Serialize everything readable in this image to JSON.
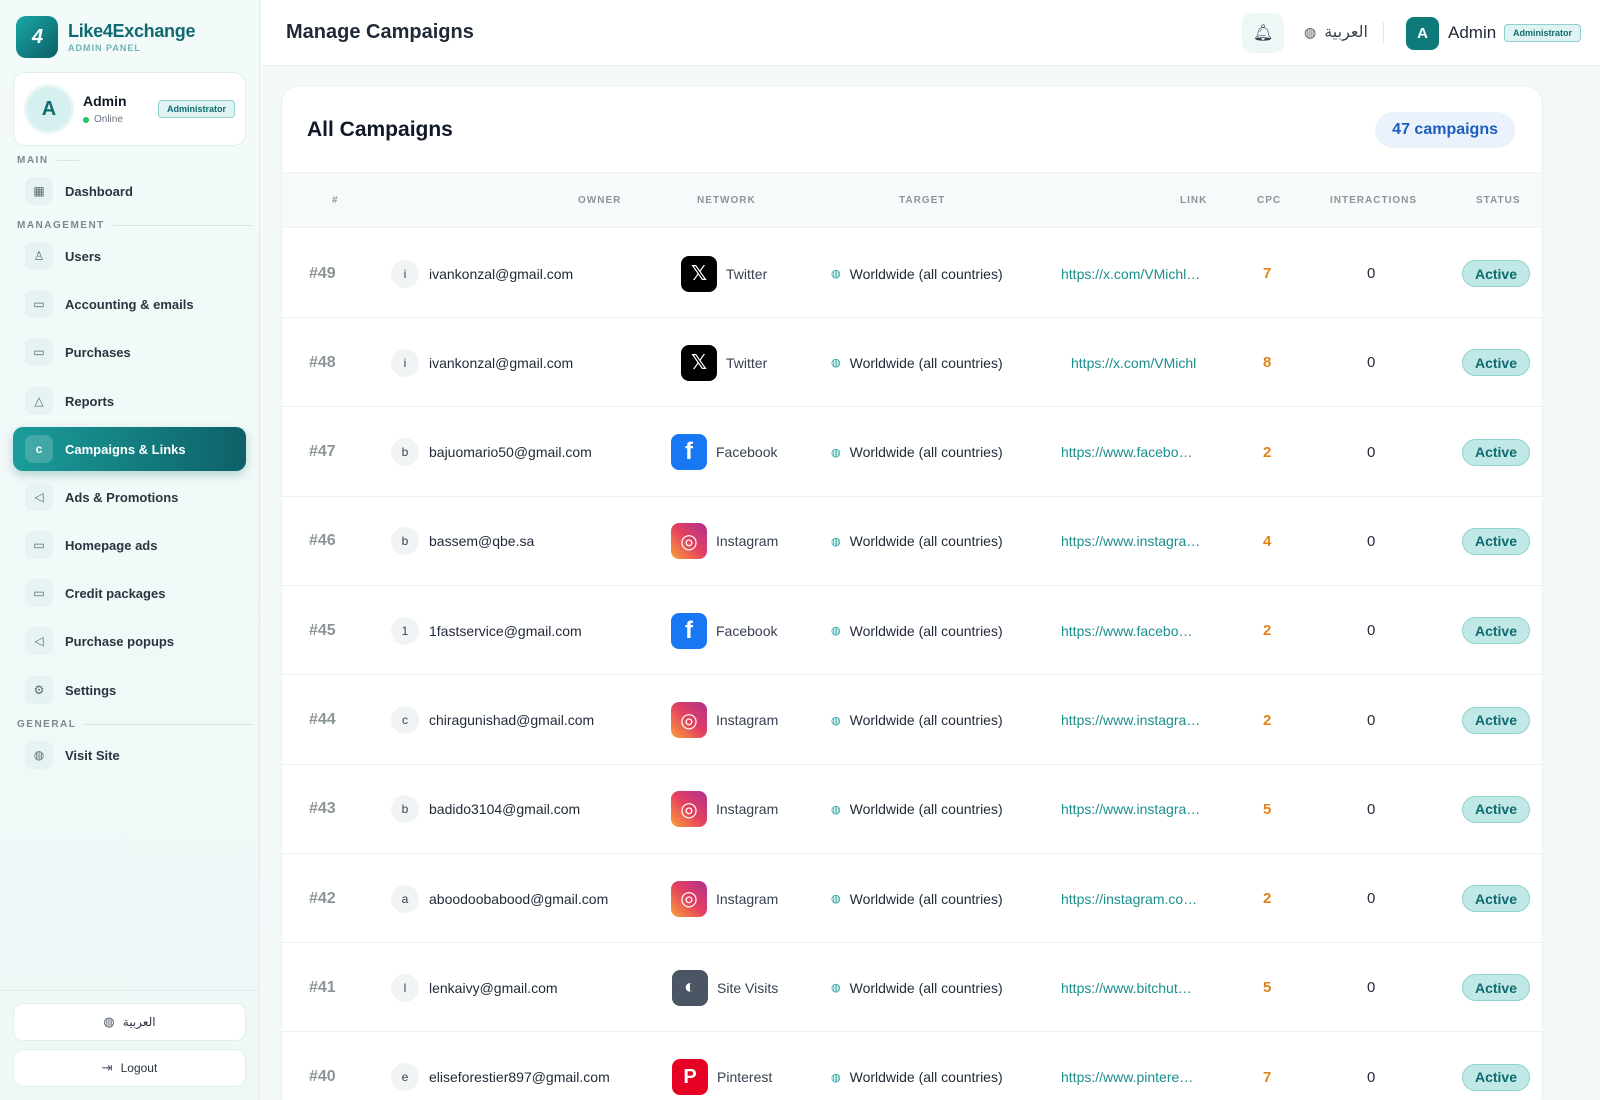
{
  "brand": {
    "name": "Like4Exchange",
    "sub": "ADMIN PANEL",
    "logo_text": "4"
  },
  "profile": {
    "initial": "A",
    "name": "Admin",
    "status": "Online",
    "role": "Administrator"
  },
  "sections": {
    "main": "MAIN",
    "management": "MANAGEMENT",
    "general": "GENERAL"
  },
  "nav": {
    "dashboard": "Dashboard",
    "users": "Users",
    "accounting": "Accounting & emails",
    "purchases": "Purchases",
    "reports": "Reports",
    "campaigns": "Campaigns & Links",
    "ads": "Ads & Promotions",
    "homepage_ads": "Homepage ads",
    "credit": "Credit packages",
    "popups": "Purchase popups",
    "settings": "Settings",
    "visit": "Visit Site"
  },
  "footer": {
    "lang": "العربية",
    "logout": "Logout"
  },
  "topbar": {
    "title": "Manage Campaigns",
    "lang": "العربية",
    "avatar": "A",
    "user": "Admin",
    "role": "Administrator"
  },
  "card": {
    "title": "All Campaigns",
    "count": "47 campaigns"
  },
  "columns": {
    "id": "#",
    "owner": "OWNER",
    "network": "NETWORK",
    "target": "TARGET",
    "link": "LINK",
    "cpc": "CPC",
    "interactions": "INTERACTIONS",
    "status": "STATUS"
  },
  "colors": {
    "accent": "#0f7a7a",
    "twitter": "#000000",
    "facebook": "#1877f2",
    "sitevisits": "#4b5563",
    "pinterest": "#e60023"
  },
  "rows": [
    {
      "id": "#49",
      "init": "i",
      "owner": "ivankonzal@gmail.com",
      "network": "Twitter",
      "icon": "x-icon",
      "target": "Worldwide (all countries)",
      "link": "https://x.com/VMichl…",
      "cpc": "7",
      "interactions": "0",
      "status": "Active"
    },
    {
      "id": "#48",
      "init": "i",
      "owner": "ivankonzal@gmail.com",
      "network": "Twitter",
      "icon": "x-icon",
      "target": "Worldwide (all countries)",
      "link": "https://x.com/VMichl",
      "cpc": "8",
      "interactions": "0",
      "status": "Active"
    },
    {
      "id": "#47",
      "init": "b",
      "owner": "bajuomario50@gmail.com",
      "network": "Facebook",
      "icon": "facebook-icon",
      "target": "Worldwide (all countries)",
      "link": "https://www.facebo…",
      "cpc": "2",
      "interactions": "0",
      "status": "Active"
    },
    {
      "id": "#46",
      "init": "b",
      "owner": "bassem@qbe.sa",
      "network": "Instagram",
      "icon": "instagram-icon",
      "target": "Worldwide (all countries)",
      "link": "https://www.instagra…",
      "cpc": "4",
      "interactions": "0",
      "status": "Active"
    },
    {
      "id": "#45",
      "init": "1",
      "owner": "1fastservice@gmail.com",
      "network": "Facebook",
      "icon": "facebook-icon",
      "target": "Worldwide (all countries)",
      "link": "https://www.facebo…",
      "cpc": "2",
      "interactions": "0",
      "status": "Active"
    },
    {
      "id": "#44",
      "init": "c",
      "owner": "chiragunishad@gmail.com",
      "network": "Instagram",
      "icon": "instagram-icon",
      "target": "Worldwide (all countries)",
      "link": "https://www.instagra…",
      "cpc": "2",
      "interactions": "0",
      "status": "Active"
    },
    {
      "id": "#43",
      "init": "b",
      "owner": "badido3104@gmail.com",
      "network": "Instagram",
      "icon": "instagram-icon",
      "target": "Worldwide (all countries)",
      "link": "https://www.instagra…",
      "cpc": "5",
      "interactions": "0",
      "status": "Active"
    },
    {
      "id": "#42",
      "init": "a",
      "owner": "aboodoobabood@gmail.com",
      "network": "Instagram",
      "icon": "instagram-icon",
      "target": "Worldwide (all countries)",
      "link": "https://instagram.co…",
      "cpc": "2",
      "interactions": "0",
      "status": "Active"
    },
    {
      "id": "#41",
      "init": "l",
      "owner": "lenkaivy@gmail.com",
      "network": "Site Visits",
      "icon": "site-visits-icon",
      "target": "Worldwide (all countries)",
      "link": "https://www.bitchut…",
      "cpc": "5",
      "interactions": "0",
      "status": "Active"
    },
    {
      "id": "#40",
      "init": "e",
      "owner": "eliseforestier897@gmail.com",
      "network": "Pinterest",
      "icon": "pinterest-icon",
      "target": "Worldwide (all countries)",
      "link": "https://www.pintere…",
      "cpc": "7",
      "interactions": "0",
      "status": "Active"
    }
  ]
}
